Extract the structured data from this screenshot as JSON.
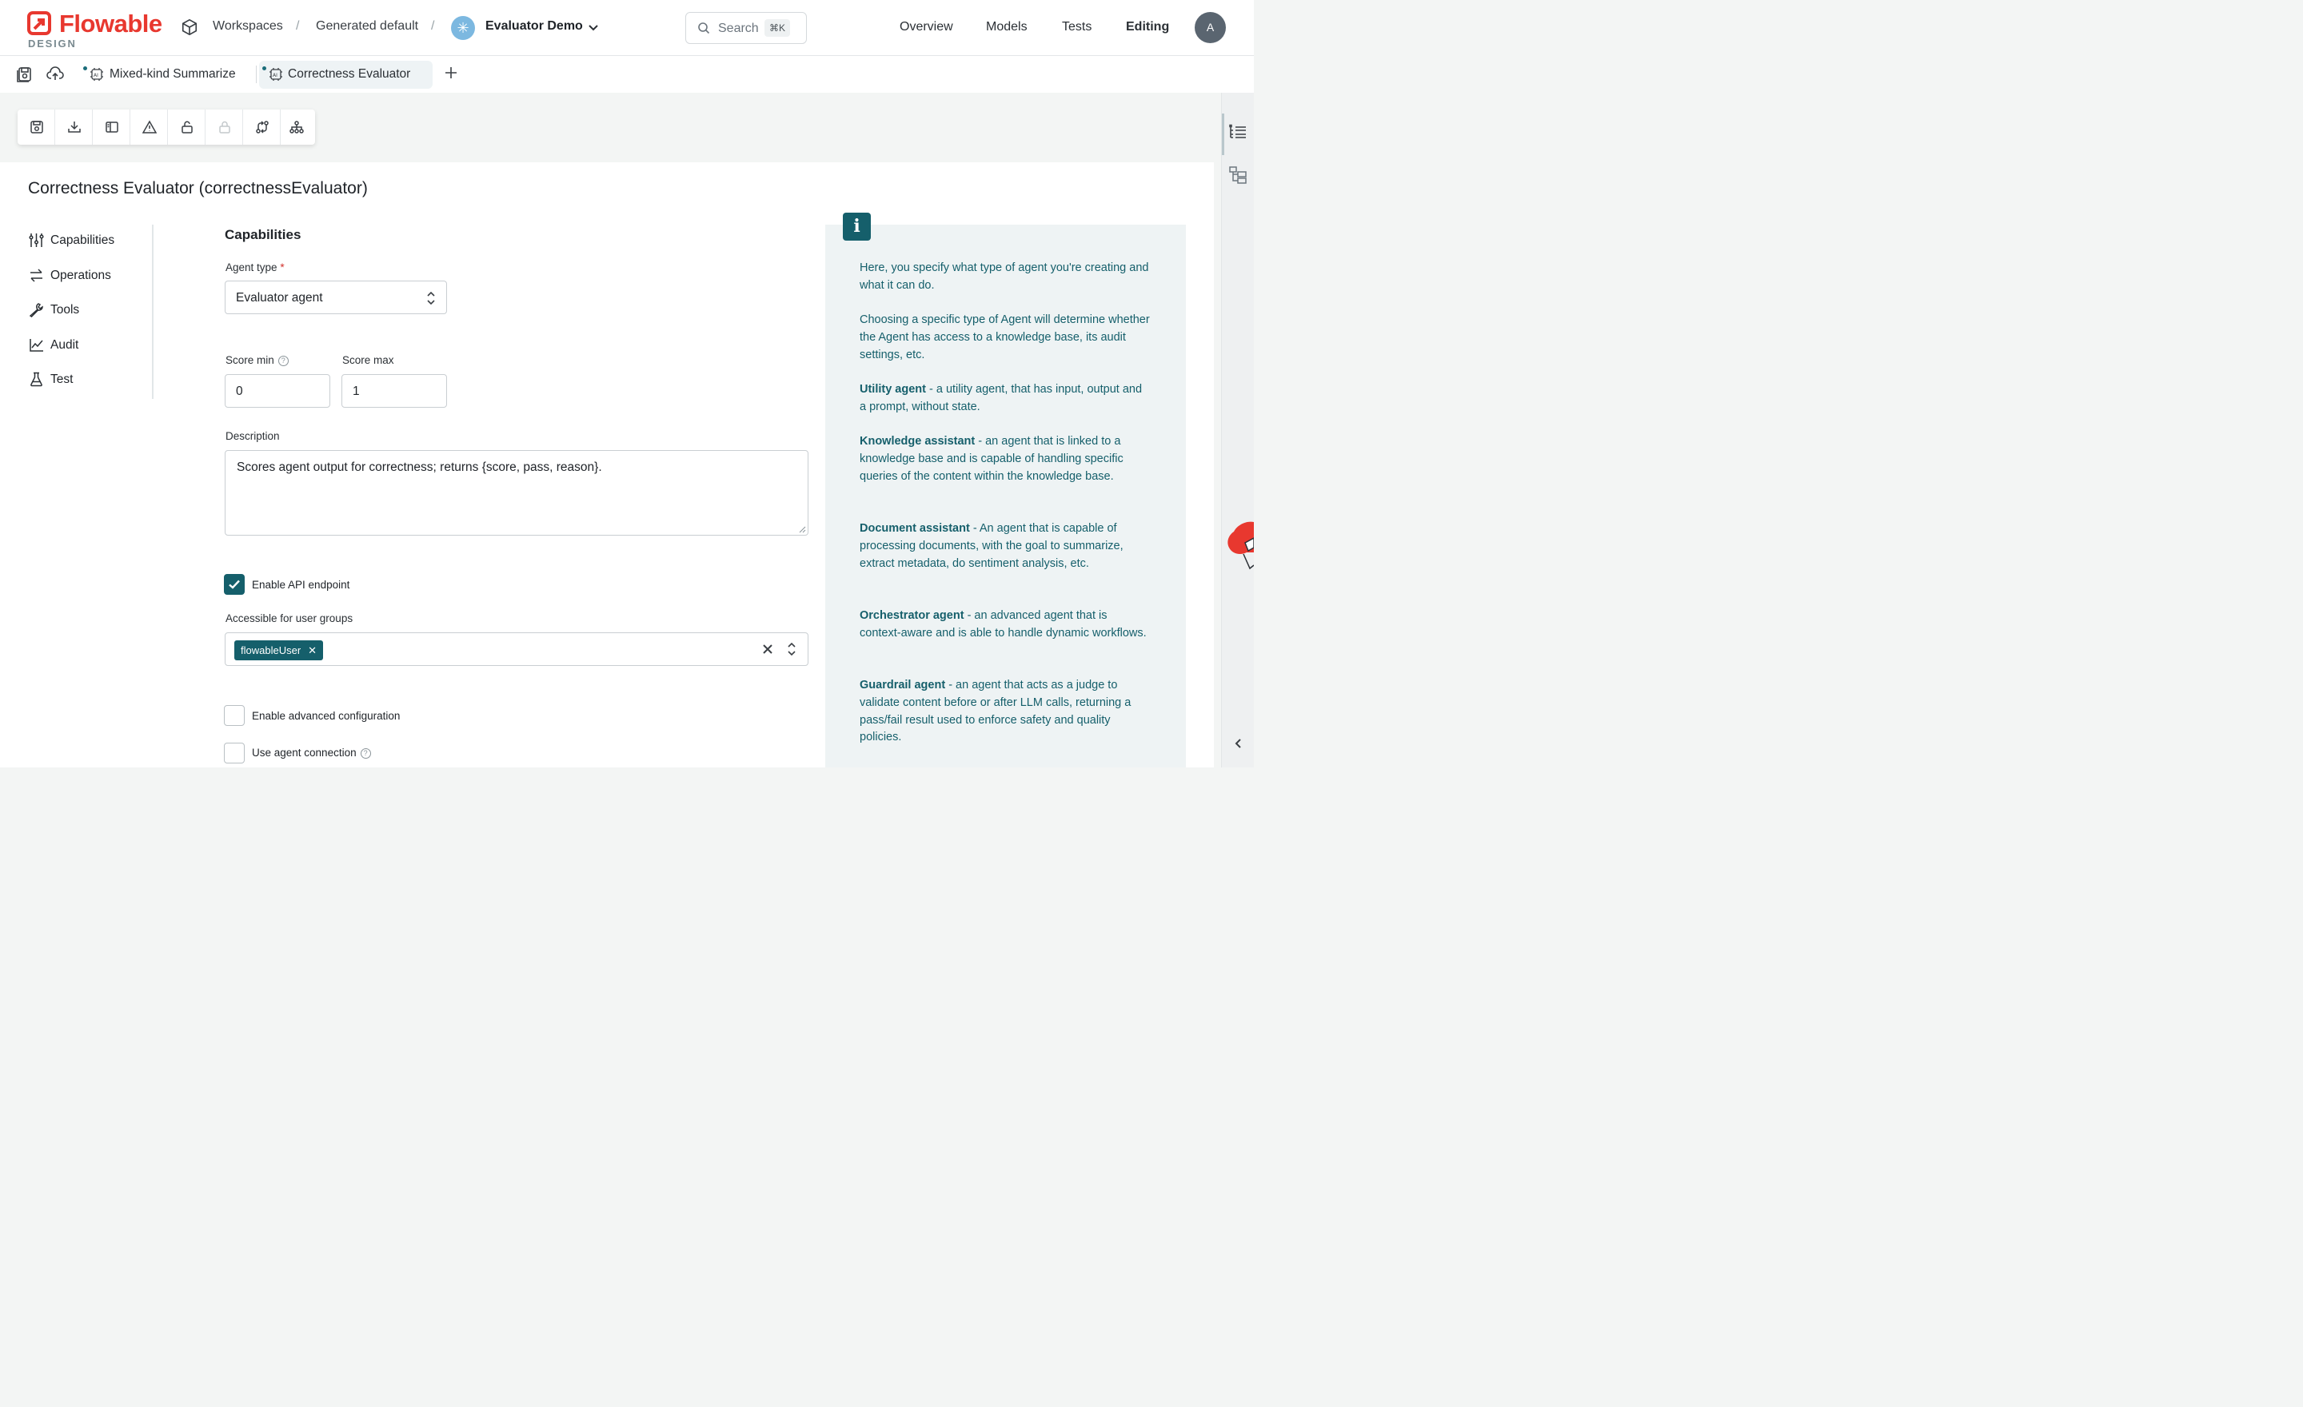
{
  "header": {
    "logo": {
      "brand": "Flowable",
      "sub": "DESIGN"
    },
    "breadcrumb": {
      "workspaces": "Workspaces",
      "generated": "Generated default",
      "app": "Evaluator Demo",
      "app_initial": "✳"
    },
    "search": {
      "placeholder": "Search",
      "shortcut": "⌘K"
    },
    "nav": {
      "overview": "Overview",
      "models": "Models",
      "tests": "Tests",
      "editing": "Editing"
    },
    "avatar": "A"
  },
  "tabs": [
    {
      "label": "Mixed-kind Summarize",
      "active": false
    },
    {
      "label": "Correctness Evaluator",
      "active": true
    }
  ],
  "page": {
    "title": "Correctness Evaluator (correctnessEvaluator)"
  },
  "sidebar": {
    "items": [
      {
        "label": "Capabilities"
      },
      {
        "label": "Operations"
      },
      {
        "label": "Tools"
      },
      {
        "label": "Audit"
      },
      {
        "label": "Test"
      }
    ]
  },
  "form": {
    "section": "Capabilities",
    "agent_type": {
      "label": "Agent type",
      "required": "*",
      "value": "Evaluator agent"
    },
    "score_min": {
      "label": "Score min",
      "value": "0"
    },
    "score_max": {
      "label": "Score max",
      "value": "1"
    },
    "description": {
      "label": "Description",
      "value": "Scores agent output for correctness; returns {score, pass, reason}."
    },
    "enable_api": {
      "label": "Enable API endpoint",
      "checked": true
    },
    "user_groups": {
      "label": "Accessible for user groups",
      "chips": [
        "flowableUser"
      ]
    },
    "advanced": {
      "label": "Enable advanced configuration",
      "checked": false
    },
    "agent_connection": {
      "label": "Use agent connection",
      "checked": false
    }
  },
  "info": {
    "badge": "i",
    "intro": "Here, you specify what type of agent you're creating and what it can do.",
    "choosing": "Choosing a specific type of Agent will determine whether the Agent has access to a knowledge base, its audit settings, etc.",
    "types": [
      {
        "name": "Utility agent",
        "text": " - a utility agent, that has input, output and a prompt, without state."
      },
      {
        "name": "Knowledge assistant",
        "text": " - an agent that is linked to a knowledge base and is capable of handling specific queries of the content within the knowledge base."
      },
      {
        "name": "Document assistant",
        "text": " - An agent that is capable of processing documents, with the goal to summarize, extract metadata, do sentiment analysis, etc."
      },
      {
        "name": "Orchestrator agent",
        "text": " - an advanced agent that is context-aware and is able to handle dynamic workflows."
      },
      {
        "name": "Guardrail agent",
        "text": " - an agent that acts as a judge to validate content before or after LLM calls, returning a pass/fail result used to enforce safety and quality policies."
      }
    ]
  },
  "colors": {
    "accent": "#155f6b",
    "brand": "#e8382f",
    "info_bg": "#eef3f4"
  }
}
